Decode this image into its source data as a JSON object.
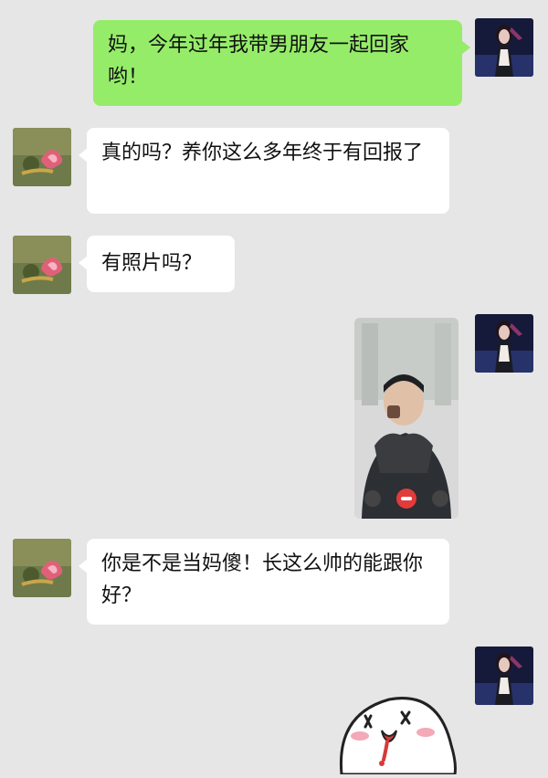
{
  "colors": {
    "background": "#e6e6e6",
    "outgoing_bubble": "#95ec69",
    "incoming_bubble": "#ffffff"
  },
  "messages": [
    {
      "side": "out",
      "text": "妈，今年过年我带男朋友一起回家哟！"
    },
    {
      "side": "in",
      "text": "真的吗？养你这么多年终于有回报了"
    },
    {
      "side": "in",
      "text": "有照片吗？"
    },
    {
      "side": "out",
      "type": "image",
      "content": "video-call-screenshot"
    },
    {
      "side": "in",
      "text": "你是不是当妈傻！长这么帅的能跟你好？"
    },
    {
      "side": "out",
      "type": "sticker",
      "content": "bun-face-sticker"
    }
  ],
  "icons": {
    "user_avatar": "user-avatar-icon",
    "mom_avatar": "mom-avatar-flower-icon"
  }
}
